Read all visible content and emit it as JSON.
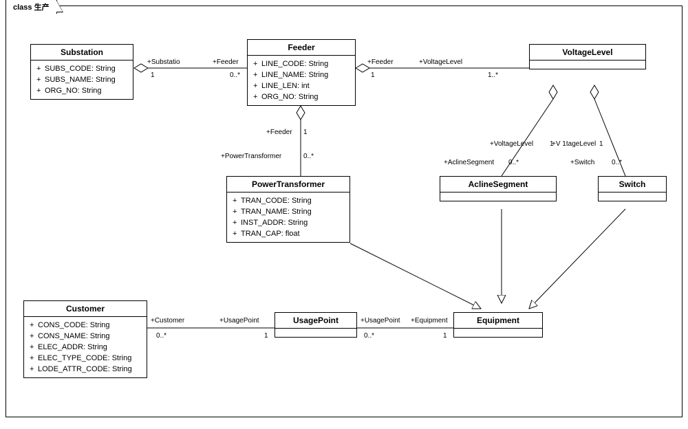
{
  "frame": {
    "title": "class 生产"
  },
  "classes": {
    "substation": {
      "name": "Substation",
      "attrs": [
        "SUBS_CODE: String",
        "SUBS_NAME: String",
        "ORG_NO: String"
      ]
    },
    "feeder": {
      "name": "Feeder",
      "attrs": [
        "LINE_CODE: String",
        "LINE_NAME: String",
        "LINE_LEN: int",
        "ORG_NO: String"
      ]
    },
    "voltageLevel": {
      "name": "VoltageLevel",
      "attrs": []
    },
    "powerTransformer": {
      "name": "PowerTransformer",
      "attrs": [
        "TRAN_CODE: String",
        "TRAN_NAME: String",
        "INST_ADDR: String",
        "TRAN_CAP: float"
      ]
    },
    "aclineSegment": {
      "name": "AclineSegment",
      "attrs": []
    },
    "switch": {
      "name": "Switch",
      "attrs": []
    },
    "customer": {
      "name": "Customer",
      "attrs": [
        "CONS_CODE: String",
        "CONS_NAME: String",
        "ELEC_ADDR: String",
        "ELEC_TYPE_CODE: String",
        "LODE_ATTR_CODE: String"
      ]
    },
    "usagePoint": {
      "name": "UsagePoint",
      "attrs": []
    },
    "equipment": {
      "name": "Equipment",
      "attrs": []
    }
  },
  "labels": {
    "sub_feed_r1": "+Substatio",
    "sub_feed_r2": "+Feeder",
    "sub_feed_m1": "1",
    "sub_feed_m2": "0..*",
    "feed_vl_r1": "+Feeder",
    "feed_vl_r2": "+VoltageLevel",
    "feed_vl_m1": "1",
    "feed_vl_m2": "1..*",
    "feed_pt_r1": "+Feeder",
    "feed_pt_r2": "+PowerTransformer",
    "feed_pt_m1": "1",
    "feed_pt_m2": "0..*",
    "vl_acl_r1": "+VoltageLevel",
    "vl_acl_r2": "+AclineSegment",
    "vl_acl_m1": "1",
    "vl_acl_m2": "0..*",
    "vl_sw_r1": "+V 1tageLevel",
    "vl_sw_r2": "+Switch",
    "vl_sw_m1": "1",
    "vl_sw_m2": "0..*",
    "cust_up_r1": "+Customer",
    "cust_up_r2": "+UsagePoint",
    "cust_up_m1": "0..*",
    "cust_up_m2": "1",
    "up_eq_r1": "+UsagePoint",
    "up_eq_r2": "+Equipment",
    "up_eq_m1": "0..*",
    "up_eq_m2": "1"
  },
  "chart_data": {
    "type": "table",
    "diagram": "UML class diagram",
    "classes": [
      {
        "name": "Substation",
        "attributes": [
          {
            "name": "SUBS_CODE",
            "type": "String"
          },
          {
            "name": "SUBS_NAME",
            "type": "String"
          },
          {
            "name": "ORG_NO",
            "type": "String"
          }
        ]
      },
      {
        "name": "Feeder",
        "attributes": [
          {
            "name": "LINE_CODE",
            "type": "String"
          },
          {
            "name": "LINE_NAME",
            "type": "String"
          },
          {
            "name": "LINE_LEN",
            "type": "int"
          },
          {
            "name": "ORG_NO",
            "type": "String"
          }
        ]
      },
      {
        "name": "VoltageLevel",
        "attributes": []
      },
      {
        "name": "PowerTransformer",
        "attributes": [
          {
            "name": "TRAN_CODE",
            "type": "String"
          },
          {
            "name": "TRAN_NAME",
            "type": "String"
          },
          {
            "name": "INST_ADDR",
            "type": "String"
          },
          {
            "name": "TRAN_CAP",
            "type": "float"
          }
        ]
      },
      {
        "name": "AclineSegment",
        "attributes": []
      },
      {
        "name": "Switch",
        "attributes": []
      },
      {
        "name": "Customer",
        "attributes": [
          {
            "name": "CONS_CODE",
            "type": "String"
          },
          {
            "name": "CONS_NAME",
            "type": "String"
          },
          {
            "name": "ELEC_ADDR",
            "type": "String"
          },
          {
            "name": "ELEC_TYPE_CODE",
            "type": "String"
          },
          {
            "name": "LODE_ATTR_CODE",
            "type": "String"
          }
        ]
      },
      {
        "name": "UsagePoint",
        "attributes": []
      },
      {
        "name": "Equipment",
        "attributes": []
      }
    ],
    "relationships": [
      {
        "from": "Substation",
        "to": "Feeder",
        "type": "aggregation",
        "aggregate_end": "Substation",
        "roles": {
          "Substation": "+Substatio",
          "Feeder": "+Feeder"
        },
        "multiplicity": {
          "Substation": "1",
          "Feeder": "0..*"
        }
      },
      {
        "from": "Feeder",
        "to": "VoltageLevel",
        "type": "aggregation",
        "aggregate_end": "Feeder",
        "roles": {
          "Feeder": "+Feeder",
          "VoltageLevel": "+VoltageLevel"
        },
        "multiplicity": {
          "Feeder": "1",
          "VoltageLevel": "1..*"
        }
      },
      {
        "from": "Feeder",
        "to": "PowerTransformer",
        "type": "aggregation",
        "aggregate_end": "Feeder",
        "roles": {
          "Feeder": "+Feeder",
          "PowerTransformer": "+PowerTransformer"
        },
        "multiplicity": {
          "Feeder": "1",
          "PowerTransformer": "0..*"
        }
      },
      {
        "from": "VoltageLevel",
        "to": "AclineSegment",
        "type": "aggregation",
        "aggregate_end": "VoltageLevel",
        "roles": {
          "VoltageLevel": "+VoltageLevel",
          "AclineSegment": "+AclineSegment"
        },
        "multiplicity": {
          "VoltageLevel": "1",
          "AclineSegment": "0..*"
        }
      },
      {
        "from": "VoltageLevel",
        "to": "Switch",
        "type": "aggregation",
        "aggregate_end": "VoltageLevel",
        "roles": {
          "VoltageLevel": "+V 1tageLevel",
          "Switch": "+Switch"
        },
        "multiplicity": {
          "VoltageLevel": "1",
          "Switch": "0..*"
        }
      },
      {
        "from": "Customer",
        "to": "UsagePoint",
        "type": "association",
        "roles": {
          "Customer": "+Customer",
          "UsagePoint": "+UsagePoint"
        },
        "multiplicity": {
          "Customer": "0..*",
          "UsagePoint": "1"
        }
      },
      {
        "from": "UsagePoint",
        "to": "Equipment",
        "type": "association",
        "roles": {
          "UsagePoint": "+UsagePoint",
          "Equipment": "+Equipment"
        },
        "multiplicity": {
          "UsagePoint": "0..*",
          "Equipment": "1"
        }
      },
      {
        "from": "PowerTransformer",
        "to": "Equipment",
        "type": "generalization"
      },
      {
        "from": "AclineSegment",
        "to": "Equipment",
        "type": "generalization"
      },
      {
        "from": "Switch",
        "to": "Equipment",
        "type": "generalization"
      }
    ]
  }
}
